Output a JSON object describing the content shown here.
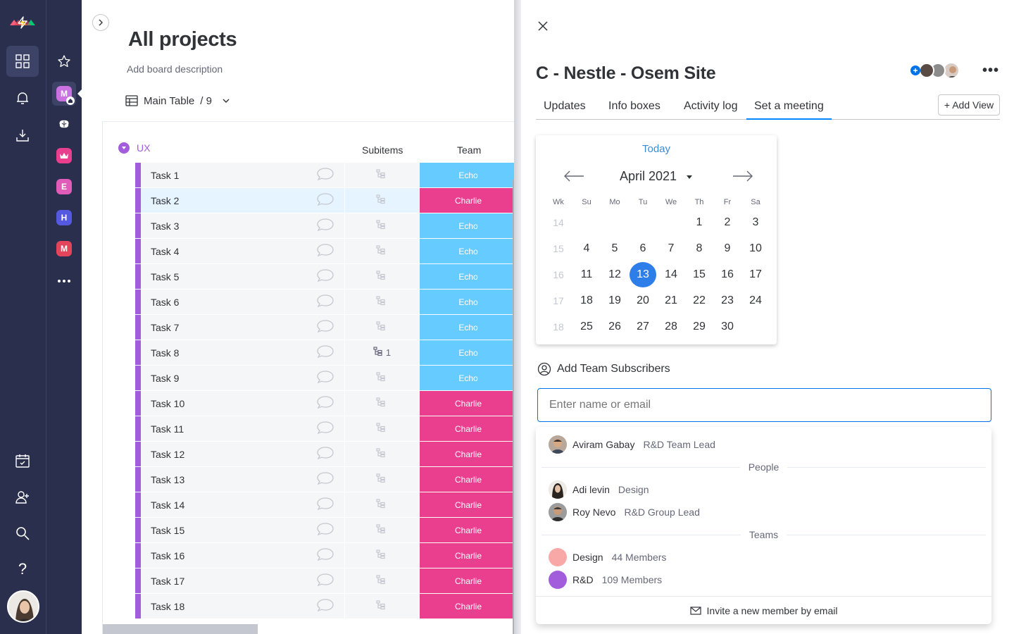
{
  "colors": {
    "rail": "#292f4c",
    "group": "#a25ddc",
    "echo": "#66ccff",
    "charlie": "#ea3e8e",
    "accent": "#0073ea",
    "selected_day": "#2d7ee8"
  },
  "rail": {
    "icons": [
      "monday-logo-icon",
      "lightning-icon",
      "grid-icon",
      "bell-icon",
      "download-icon",
      "calendar-check-icon",
      "add-user-icon",
      "search-icon",
      "help-icon"
    ],
    "help_label": "?"
  },
  "workspaces": [
    {
      "letter": "M",
      "color": "#c972e0"
    },
    {
      "letter": "",
      "color": "#292f4c"
    },
    {
      "letter": "",
      "color": "#ea3e8e"
    },
    {
      "letter": "E",
      "color": "#e05cb8"
    },
    {
      "letter": "H",
      "color": "#5559df"
    },
    {
      "letter": "M",
      "color": "#e2445c"
    }
  ],
  "board": {
    "title": "All projects",
    "description": "Add board description",
    "view_name": "Main Table",
    "view_count": "/ 9",
    "group_name": "UX",
    "columns": {
      "subitems": "Subitems",
      "team": "Team"
    },
    "rows": [
      {
        "name": "Task 1",
        "subitems": "",
        "team": "Echo"
      },
      {
        "name": "Task 2",
        "subitems": "",
        "team": "Charlie"
      },
      {
        "name": "Task 3",
        "subitems": "",
        "team": "Echo"
      },
      {
        "name": "Task 4",
        "subitems": "",
        "team": "Echo"
      },
      {
        "name": "Task 5",
        "subitems": "",
        "team": "Echo"
      },
      {
        "name": "Task 6",
        "subitems": "",
        "team": "Echo"
      },
      {
        "name": "Task 7",
        "subitems": "",
        "team": "Echo"
      },
      {
        "name": "Task 8",
        "subitems": "1",
        "team": "Echo"
      },
      {
        "name": "Task 9",
        "subitems": "",
        "team": "Echo"
      },
      {
        "name": "Task 10",
        "subitems": "",
        "team": "Charlie"
      },
      {
        "name": "Task 11",
        "subitems": "",
        "team": "Charlie"
      },
      {
        "name": "Task 12",
        "subitems": "",
        "team": "Charlie"
      },
      {
        "name": "Task 13",
        "subitems": "",
        "team": "Charlie"
      },
      {
        "name": "Task 14",
        "subitems": "",
        "team": "Charlie"
      },
      {
        "name": "Task 15",
        "subitems": "",
        "team": "Charlie"
      },
      {
        "name": "Task 16",
        "subitems": "",
        "team": "Charlie"
      },
      {
        "name": "Task 17",
        "subitems": "",
        "team": "Charlie"
      },
      {
        "name": "Task 18",
        "subitems": "",
        "team": "Charlie"
      }
    ]
  },
  "panel": {
    "title": "C - Nestle - Osem Site",
    "more_label": "•••",
    "tabs": [
      "Updates",
      "Info boxes",
      "Activity log",
      "Set a meeting"
    ],
    "active_tab": "Set a meeting",
    "add_view": "+ Add View",
    "calendar": {
      "today_label": "Today",
      "month_label": "April 2021",
      "weekday_headers": [
        "Wk",
        "Su",
        "Mo",
        "Tu",
        "We",
        "Th",
        "Fr",
        "Sa"
      ],
      "weeks": [
        {
          "wk": "14",
          "days": [
            "",
            "",
            "",
            "",
            "1",
            "2",
            "3"
          ]
        },
        {
          "wk": "15",
          "days": [
            "4",
            "5",
            "6",
            "7",
            "8",
            "9",
            "10"
          ]
        },
        {
          "wk": "16",
          "days": [
            "11",
            "12",
            "13",
            "14",
            "15",
            "16",
            "17"
          ]
        },
        {
          "wk": "17",
          "days": [
            "18",
            "19",
            "20",
            "21",
            "22",
            "23",
            "24"
          ]
        },
        {
          "wk": "18",
          "days": [
            "25",
            "26",
            "27",
            "28",
            "29",
            "30",
            ""
          ]
        }
      ],
      "selected_day": "13"
    },
    "subscribers": {
      "heading": "Add Team Subscribers",
      "placeholder": "Enter name or email",
      "suggested": {
        "name": "Aviram Gabay",
        "role": "R&D Team Lead"
      },
      "people_label": "People",
      "people": [
        {
          "name": "Adi levin",
          "role": "Design"
        },
        {
          "name": "Roy Nevo",
          "role": "R&D Group Lead"
        }
      ],
      "teams_label": "Teams",
      "teams": [
        {
          "name": "Design",
          "members": "44 Members",
          "color": "#f9a8a8"
        },
        {
          "name": "R&D",
          "members": "109 Members",
          "color": "#a25ddc"
        }
      ],
      "invite_label": "Invite a new member by email"
    }
  }
}
